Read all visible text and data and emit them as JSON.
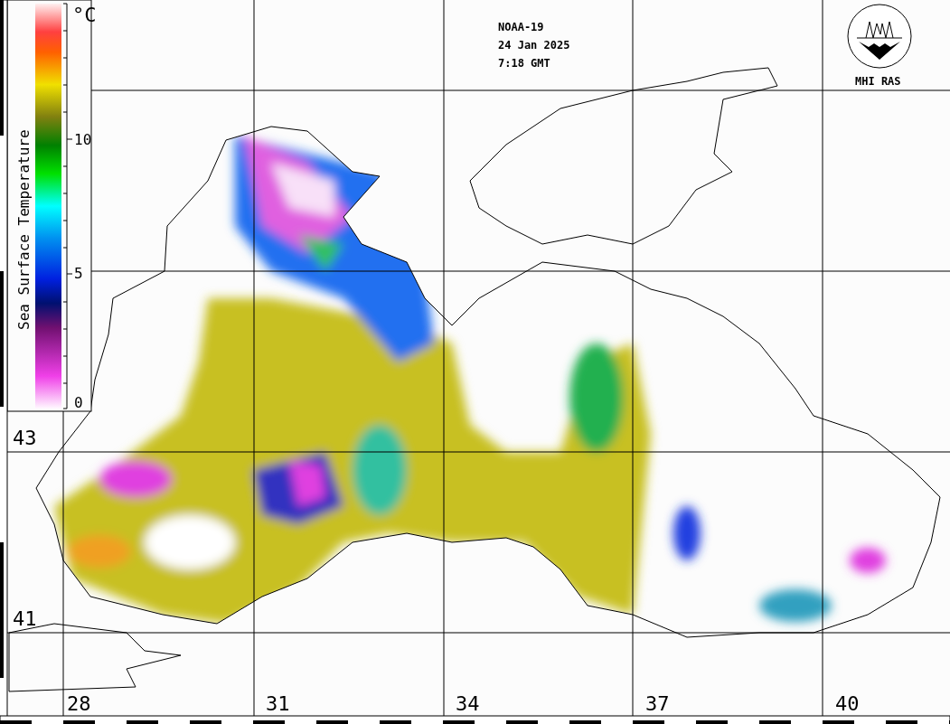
{
  "header": {
    "lines": [
      "NOAA-19",
      "24 Jan 2025",
      "7:18 GMT"
    ]
  },
  "logo": {
    "label": "MHI RAS"
  },
  "colorbar": {
    "title": "Sea Surface Temperature",
    "unit": "°C",
    "ticks": [
      "10",
      "5",
      "0"
    ]
  },
  "latitudes": [
    "43",
    "41"
  ],
  "longitudes": [
    "28",
    "31",
    "34",
    "37",
    "40"
  ]
}
